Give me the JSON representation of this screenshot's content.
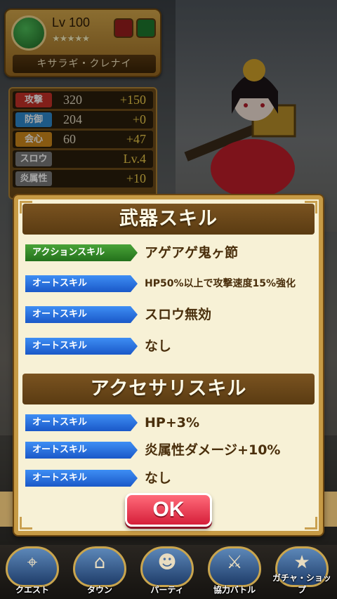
{
  "character": {
    "level": "Lv 100",
    "stars": "★★★★★",
    "name": "キサラギ・クレナイ"
  },
  "stats": [
    {
      "label": "攻撃",
      "value": "320",
      "bonus": "+150",
      "color": "#c83228"
    },
    {
      "label": "防御",
      "value": "204",
      "bonus": "+0",
      "color": "#2e8ad0"
    },
    {
      "label": "会心",
      "value": "60",
      "bonus": "+47",
      "color": "#d18a1d"
    },
    {
      "label": "スロウ",
      "value": "",
      "bonus": "Lv.4",
      "color": "#7b7b7b"
    },
    {
      "label": "炎属性",
      "value": "",
      "bonus": "+10",
      "color": "#7b7b7b"
    }
  ],
  "dialog": {
    "weapon_title": "武器スキル",
    "weapon_skills": [
      {
        "type": "アクションスキル",
        "name": "アゲアゲ鬼ヶ節"
      },
      {
        "type": "オートスキル",
        "name": "HP50%以上で攻撃速度15%強化"
      },
      {
        "type": "オートスキル",
        "name": "スロウ無効"
      },
      {
        "type": "オートスキル",
        "name": "なし"
      }
    ],
    "accessory_title": "アクセサリスキル",
    "accessory_skills": [
      {
        "type": "オートスキル",
        "name": "HP+3%"
      },
      {
        "type": "オートスキル",
        "name": "炎属性ダメージ+10%"
      },
      {
        "type": "オートスキル",
        "name": "なし"
      }
    ],
    "ok_label": "OK"
  },
  "nav": [
    {
      "label": "クエスト",
      "icon": "map-icon"
    },
    {
      "label": "タウン",
      "icon": "town-icon"
    },
    {
      "label": "パーティ",
      "icon": "party-icon"
    },
    {
      "label": "協力バトル",
      "icon": "coop-battle-icon"
    },
    {
      "label": "ガチャ・ショップ",
      "icon": "gacha-shop-icon"
    }
  ],
  "colors": {
    "action_tag": "#23711b",
    "auto_tag": "#1a58c8",
    "ok_button": "#d61f3a",
    "dialog_bg": "#f7f1d6"
  }
}
